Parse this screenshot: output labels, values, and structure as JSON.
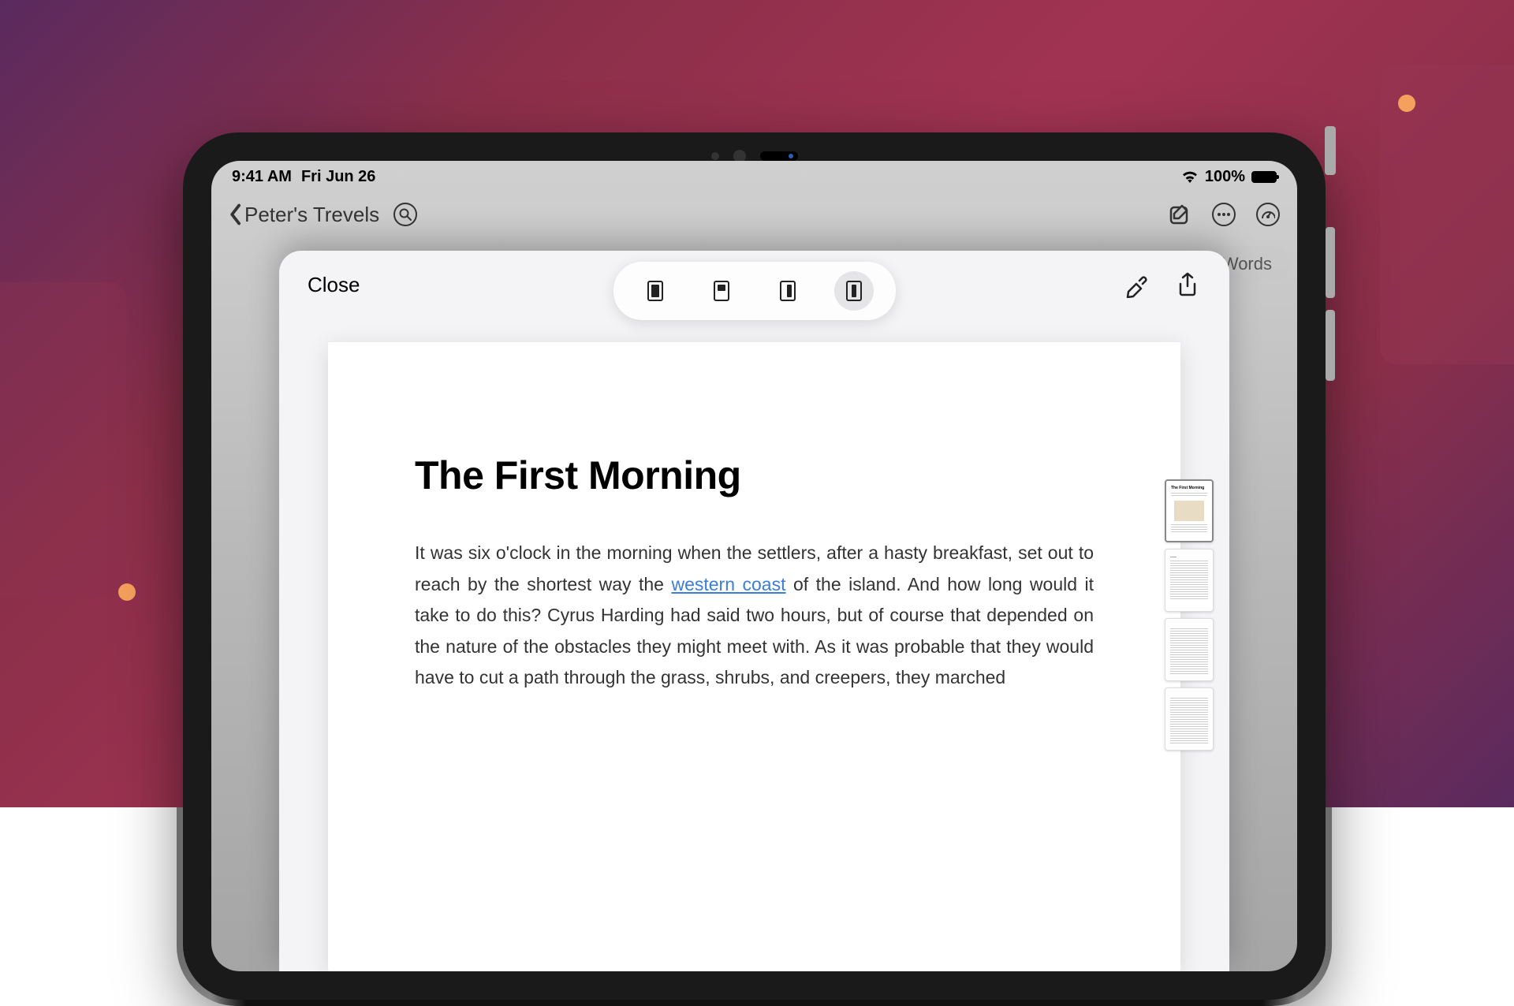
{
  "status": {
    "time": "9:41 AM",
    "date": "Fri Jun 26",
    "battery": "100%"
  },
  "nav": {
    "back_label": "Peter's Trevels"
  },
  "badge": {
    "words": "Words"
  },
  "sheet": {
    "close_label": "Close",
    "layout_options": [
      "full",
      "top",
      "right",
      "center"
    ],
    "selected_layout_index": 3
  },
  "document": {
    "title": "The First Morning",
    "body_pre": "It was six o'clock in the morning when the settlers, after a hasty breakfast, set out to reach by the shortest way the ",
    "link_text": "western coast",
    "body_post": " of the island. And how long would it take to do this? Cyrus Harding had said two hours, but of course that depended on the nature of the obstacles they might meet with. As it was probable that they would have to cut a path through the grass, shrubs, and creepers, they marched"
  },
  "thumbnails": {
    "count": 4,
    "active_index": 0
  }
}
